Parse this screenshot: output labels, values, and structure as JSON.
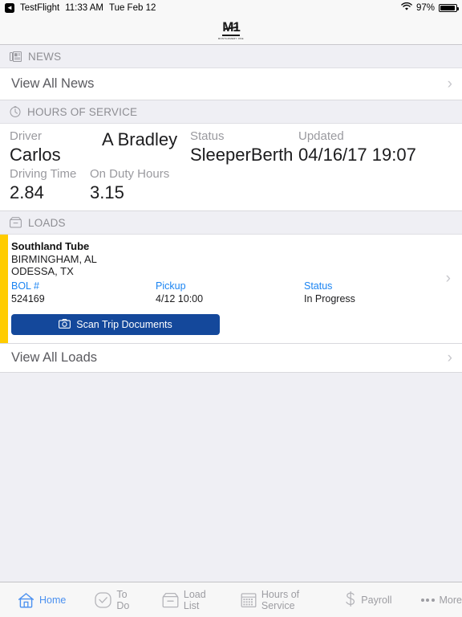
{
  "status_bar": {
    "back_app": "TestFlight",
    "back_icon": "back-chevron-icon",
    "time": "11:33 AM",
    "date": "Tue Feb 12",
    "wifi_icon": "wifi-icon",
    "battery_percent": "97%",
    "battery_level": 97
  },
  "navbar": {
    "logo_mark": "M1",
    "logo_subtitle": "MONTGOMERY ONE"
  },
  "news": {
    "header": "NEWS",
    "header_icon": "newspaper-icon",
    "view_all_label": "View All News",
    "chevron_icon": "chevron-right-icon"
  },
  "hours_of_service": {
    "header": "HOURS OF SERVICE",
    "header_icon": "clock-icon",
    "fields": [
      {
        "label": "Driver",
        "value": "Carlos"
      },
      {
        "label": "",
        "value": "A Bradley"
      },
      {
        "label": "Status",
        "value": "SleeperBerth"
      },
      {
        "label": "Updated",
        "value": "04/16/17 19:07"
      }
    ],
    "fields2": [
      {
        "label": "Driving Time",
        "value": "2.84"
      },
      {
        "label": "On Duty Hours",
        "value": "3.15"
      }
    ]
  },
  "loads": {
    "header": "LOADS",
    "header_icon": "box-icon",
    "stripe_color": "#ffcc00",
    "card": {
      "customer": "Southland Tube",
      "origin": "BIRMINGHAM, AL",
      "destination": "ODESSA, TX",
      "columns": [
        {
          "header": "BOL #",
          "value": "524169"
        },
        {
          "header": "Pickup",
          "value": "4/12 10:00"
        },
        {
          "header": "Status",
          "value": "In Progress"
        }
      ],
      "scan_button_label": "Scan Trip Documents",
      "scan_button_icon": "camera-icon",
      "scan_button_color": "#14489b",
      "chevron_icon": "chevron-right-icon"
    },
    "view_all_label": "View All Loads",
    "chevron_icon": "chevron-right-icon"
  },
  "tabbar": {
    "accent_color": "#4a90f0",
    "inactive_color": "#9d9da2",
    "items": [
      {
        "label": "Home",
        "icon": "home-icon",
        "active": true
      },
      {
        "label": "To Do",
        "icon": "checkmark-circle-icon",
        "active": false
      },
      {
        "label": "Load List",
        "icon": "box-icon",
        "active": false
      },
      {
        "label": "Hours of Service",
        "icon": "calendar-icon",
        "active": false
      },
      {
        "label": "Payroll",
        "icon": "dollar-icon",
        "active": false
      },
      {
        "label": "More",
        "icon": "ellipsis-icon",
        "active": false
      }
    ]
  }
}
